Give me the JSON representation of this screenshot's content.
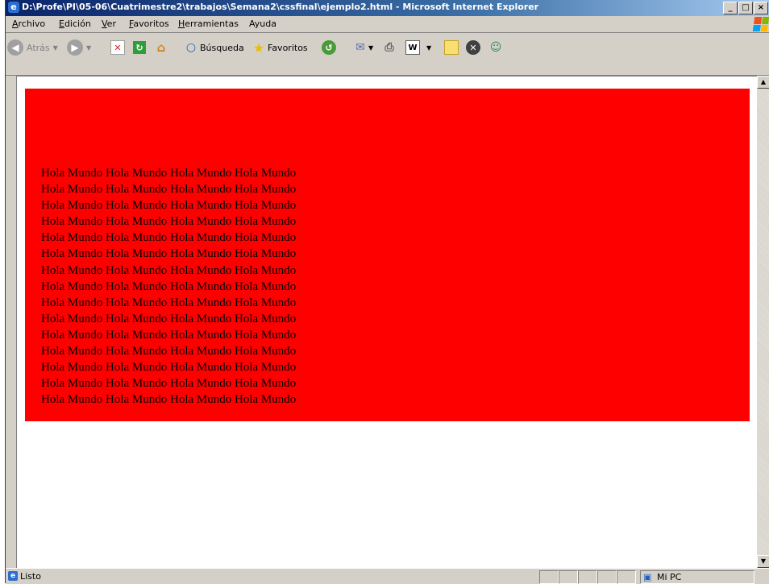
{
  "window": {
    "title": "D:\\Profe\\PI\\05-06\\Cuatrimestre2\\trabajos\\Semana2\\cssfinal\\ejemplo2.html - Microsoft Internet Explorer",
    "controls": [
      "_",
      "□",
      "×"
    ]
  },
  "menu": {
    "items": [
      {
        "first": "A",
        "rest": "rchivo"
      },
      {
        "first": "E",
        "rest": "dición"
      },
      {
        "first": "V",
        "rest": "er"
      },
      {
        "first": "F",
        "rest": "avoritos"
      },
      {
        "first": "H",
        "rest": "erramientas"
      },
      {
        "first": "Ay",
        "rest": "uda"
      }
    ]
  },
  "toolbar": {
    "back_label": "Atrás",
    "search_label": "Búsqueda",
    "favorites_label": "Favoritos",
    "word_label": "W"
  },
  "page": {
    "background_color": "#ff0000",
    "line_text": "Hola Mundo Hola Mundo Hola Mundo Hola Mundo",
    "line_count": 15
  },
  "status": {
    "text": "Listo",
    "zone": "Mi PC"
  }
}
